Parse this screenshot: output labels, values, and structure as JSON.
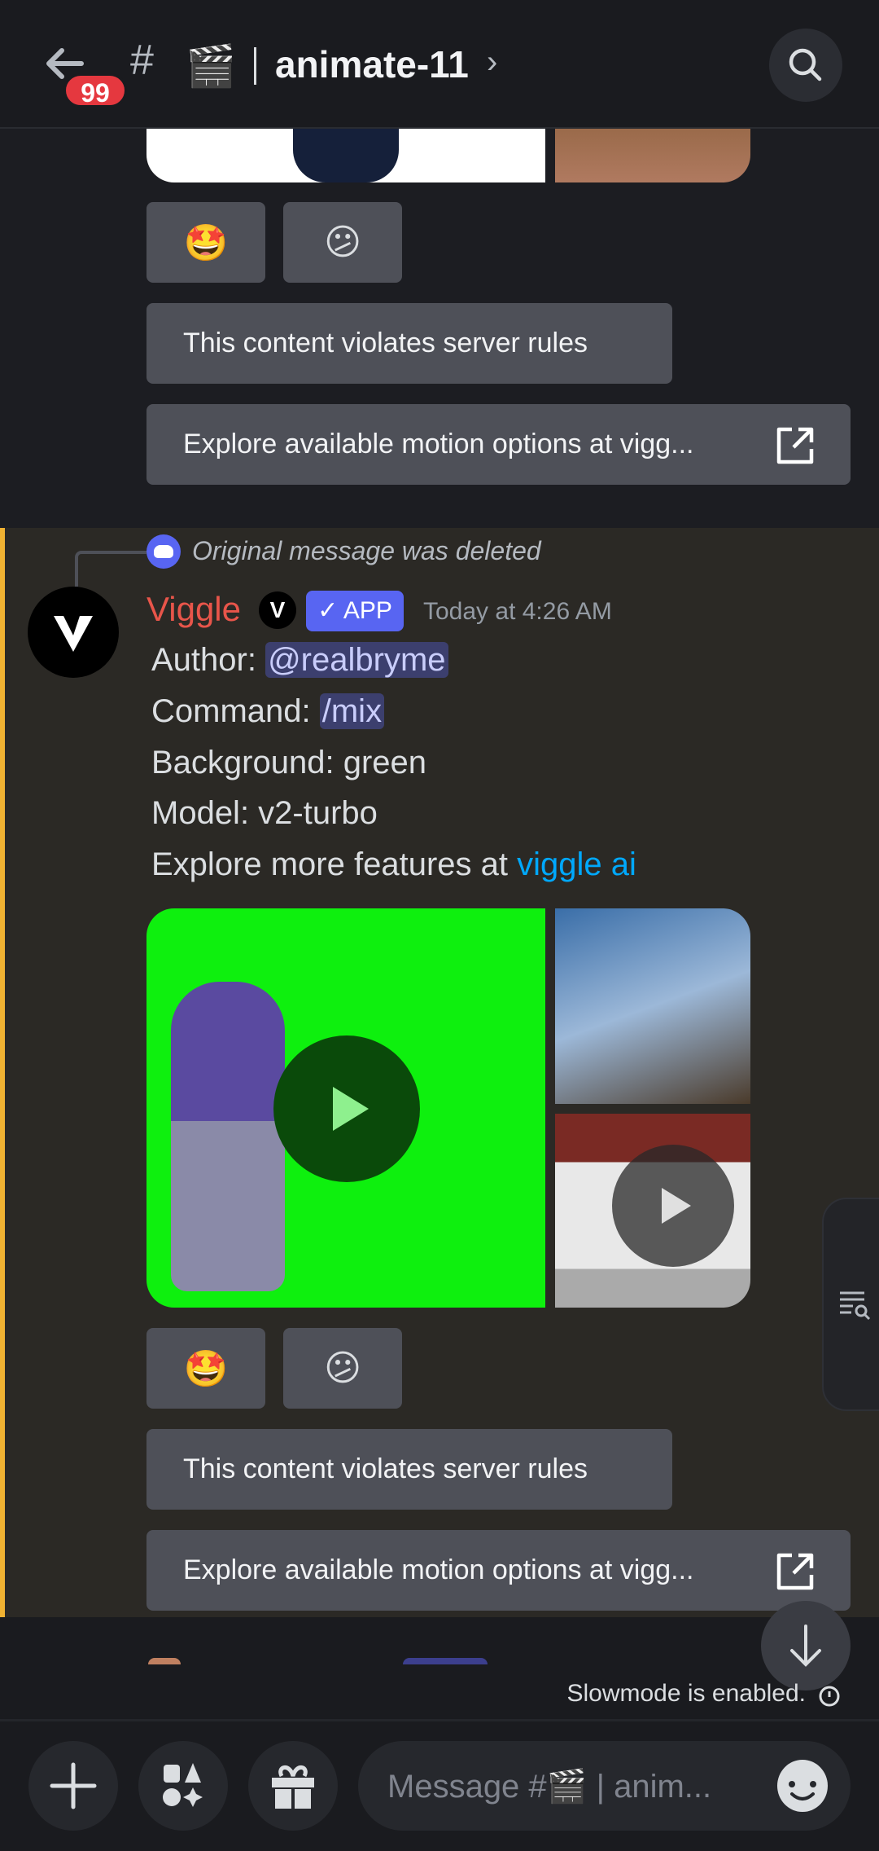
{
  "header": {
    "unread_count": "99",
    "hash": "#",
    "channel_emoji": "🎬",
    "channel_name": "animate-11",
    "chevron": "›",
    "back_icon": "arrow-left-icon",
    "search_icon": "search-icon"
  },
  "previous_message": {
    "reactions": [
      {
        "emoji": "🤩"
      },
      {
        "emoji": "😕"
      }
    ],
    "buttons": {
      "violates": "This content violates server rules",
      "explore": "Explore available motion options at vigg..."
    }
  },
  "message": {
    "reply_text": "Original message was deleted",
    "author": "Viggle",
    "app_badge": "✓ APP",
    "timestamp": "Today at 4:26 AM",
    "lines": {
      "author_label": "Author: ",
      "author_value": "@realbryme",
      "command_label": "Command: ",
      "command_value": "/mix",
      "background": "Background: green",
      "model": "Model: v2-turbo",
      "explore_label": "Explore more features at ",
      "explore_link": "viggle ai"
    },
    "reactions": [
      {
        "emoji": "🤩"
      },
      {
        "emoji": "😕"
      }
    ],
    "buttons": {
      "violates": "This content violates server rules",
      "explore": "Explore available motion options at vigg..."
    }
  },
  "slowmode": "Slowmode is enabled.",
  "composer": {
    "placeholder": "Message #🎬 | anim..."
  },
  "colors": {
    "accent": "#5865f2",
    "author": "#e8554a",
    "link": "#00a8fc",
    "highlight_bar": "#f0b232",
    "badge": "#e5383f"
  }
}
